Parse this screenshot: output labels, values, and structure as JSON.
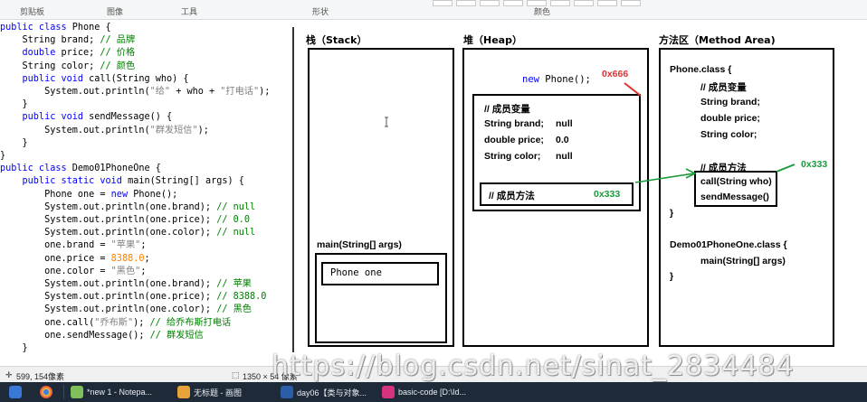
{
  "ribbon": {
    "groups": [
      "剪贴板",
      "图像",
      "工具",
      "形状",
      "颜色"
    ]
  },
  "code_lines": [
    [
      [
        "kw",
        "public class "
      ],
      [
        "",
        "Phone {"
      ]
    ],
    [
      [
        "",
        "    String brand; "
      ],
      [
        "cm",
        "// 品牌"
      ]
    ],
    [
      [
        "kw",
        "    double "
      ],
      [
        "",
        "price; "
      ],
      [
        "cm",
        "// 价格"
      ]
    ],
    [
      [
        "",
        "    String color; "
      ],
      [
        "cm",
        "// 颜色"
      ]
    ],
    [
      [
        "kw",
        "    public void "
      ],
      [
        "",
        "call(String who) {"
      ]
    ],
    [
      [
        "",
        "        System.out.println("
      ],
      [
        "st",
        "\"给\""
      ],
      [
        "",
        " + who + "
      ],
      [
        "st",
        "\"打电话\""
      ],
      [
        "",
        ");"
      ]
    ],
    [
      [
        "",
        "    }"
      ]
    ],
    [
      [
        "kw",
        "    public void "
      ],
      [
        "",
        "sendMessage() {"
      ]
    ],
    [
      [
        "",
        "        System.out.println("
      ],
      [
        "st",
        "\"群发短信\""
      ],
      [
        "",
        ");"
      ]
    ],
    [
      [
        "",
        "    }"
      ]
    ],
    [
      [
        "",
        "}"
      ]
    ],
    [
      [
        "kw",
        "public class "
      ],
      [
        "",
        "Demo01PhoneOne {"
      ]
    ],
    [
      [
        "kw",
        "    public static void "
      ],
      [
        "",
        "main(String[] args) {"
      ]
    ],
    [
      [
        "",
        "        Phone one = "
      ],
      [
        "kw",
        "new "
      ],
      [
        "",
        "Phone();"
      ]
    ],
    [
      [
        "",
        "        System.out.println(one.brand); "
      ],
      [
        "cm",
        "// null"
      ]
    ],
    [
      [
        "",
        "        System.out.println(one.price); "
      ],
      [
        "cm",
        "// 0.0"
      ]
    ],
    [
      [
        "",
        "        System.out.println(one.color); "
      ],
      [
        "cm",
        "// null"
      ]
    ],
    [
      [
        "",
        "        one.brand = "
      ],
      [
        "st",
        "\"苹果\""
      ],
      [
        "",
        ";"
      ]
    ],
    [
      [
        "",
        "        one.price = "
      ],
      [
        "nm",
        "8388.0"
      ],
      [
        "",
        ";"
      ]
    ],
    [
      [
        "",
        "        one.color = "
      ],
      [
        "st",
        "\"黑色\""
      ],
      [
        "",
        ";"
      ]
    ],
    [
      [
        "",
        "        System.out.println(one.brand); "
      ],
      [
        "cm",
        "// 苹果"
      ]
    ],
    [
      [
        "",
        "        System.out.println(one.price); "
      ],
      [
        "cm",
        "// 8388.0"
      ]
    ],
    [
      [
        "",
        "        System.out.println(one.color); "
      ],
      [
        "cm",
        "// 黑色"
      ]
    ],
    [
      [
        "",
        "        one.call("
      ],
      [
        "st",
        "\"乔布斯\""
      ],
      [
        "",
        "); "
      ],
      [
        "cm",
        "// 给乔布斯打电话"
      ]
    ],
    [
      [
        "",
        "        one.sendMessage(); "
      ],
      [
        "cm",
        "// 群发短信"
      ]
    ],
    [
      [
        "",
        "    }"
      ]
    ]
  ],
  "diagram": {
    "stack_title": "栈（Stack）",
    "heap_title": "堆（Heap）",
    "method_title": "方法区（Method Area)",
    "main_frame_label": "main(String[] args)",
    "phone_one_label": "Phone  one",
    "new_phone_prefix": "new",
    "new_phone_text": "Phone();",
    "addr_object": "0x666",
    "addr_method": "0x333",
    "heap_members_title": "// 成员变量",
    "heap_brand": "String brand;",
    "heap_brand_val": "null",
    "heap_price": "double price;",
    "heap_price_val": "0.0",
    "heap_color": "String color;",
    "heap_color_val": "null",
    "heap_methods_title": "// 成员方法",
    "heap_methods_addr": "0x333",
    "class_header": "Phone.class {",
    "class_members_title": "// 成员变量",
    "class_brand": "String brand;",
    "class_price": "double price;",
    "class_color": "String color;",
    "class_methods_title": "// 成员方法",
    "class_method_call": "call(String who)",
    "class_method_send": "sendMessage()",
    "class_close": "}",
    "demo_header": "Demo01PhoneOne.class {",
    "demo_main": "main(String[] args)",
    "demo_close": "}"
  },
  "status": {
    "cursor": "599, 154像素",
    "size": "1350 × 54 像素"
  },
  "watermark": "https://blog.csdn.net/sinat_2834484",
  "taskbar": {
    "items": [
      "*new 1 - Notepa...",
      "无标题 - 画图",
      "day06【类与对象...",
      "basic-code [D:\\Id..."
    ]
  }
}
